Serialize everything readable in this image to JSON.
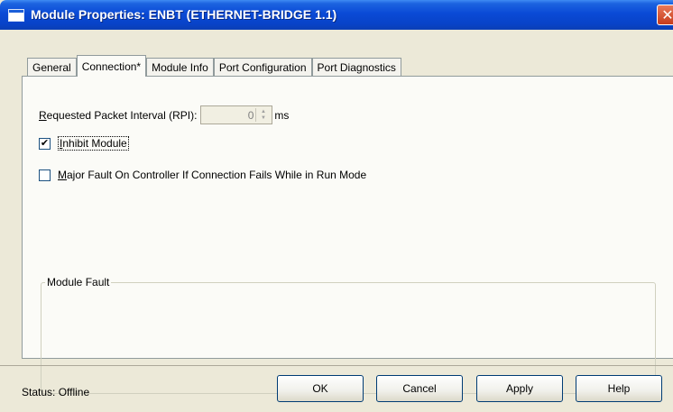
{
  "window": {
    "title": "Module Properties: ENBT (ETHERNET-BRIDGE 1.1)",
    "close_glyph": "✕",
    "title_icon": "window-icon"
  },
  "tabs": [
    {
      "label": "General",
      "active": false
    },
    {
      "label": "Connection*",
      "active": true
    },
    {
      "label": "Module Info",
      "active": false
    },
    {
      "label": "Port Configuration",
      "active": false
    },
    {
      "label": "Port Diagnostics",
      "active": false
    }
  ],
  "connection": {
    "rpi_label_prefix": "R",
    "rpi_label_rest": "equested Packet Interval (RPI):",
    "rpi_value": "0",
    "rpi_unit": "ms",
    "inhibit_prefix": "I",
    "inhibit_rest": "nhibit Module",
    "inhibit_checked": true,
    "major_fault_prefix": "M",
    "major_fault_rest": "ajor Fault On Controller If Connection Fails While in Run Mode",
    "major_fault_checked": false,
    "module_fault_label": "Module Fault"
  },
  "status": {
    "text": "Status:  Offline"
  },
  "buttons": {
    "ok": "OK",
    "cancel": "Cancel",
    "apply": "Apply",
    "help": "Help"
  }
}
